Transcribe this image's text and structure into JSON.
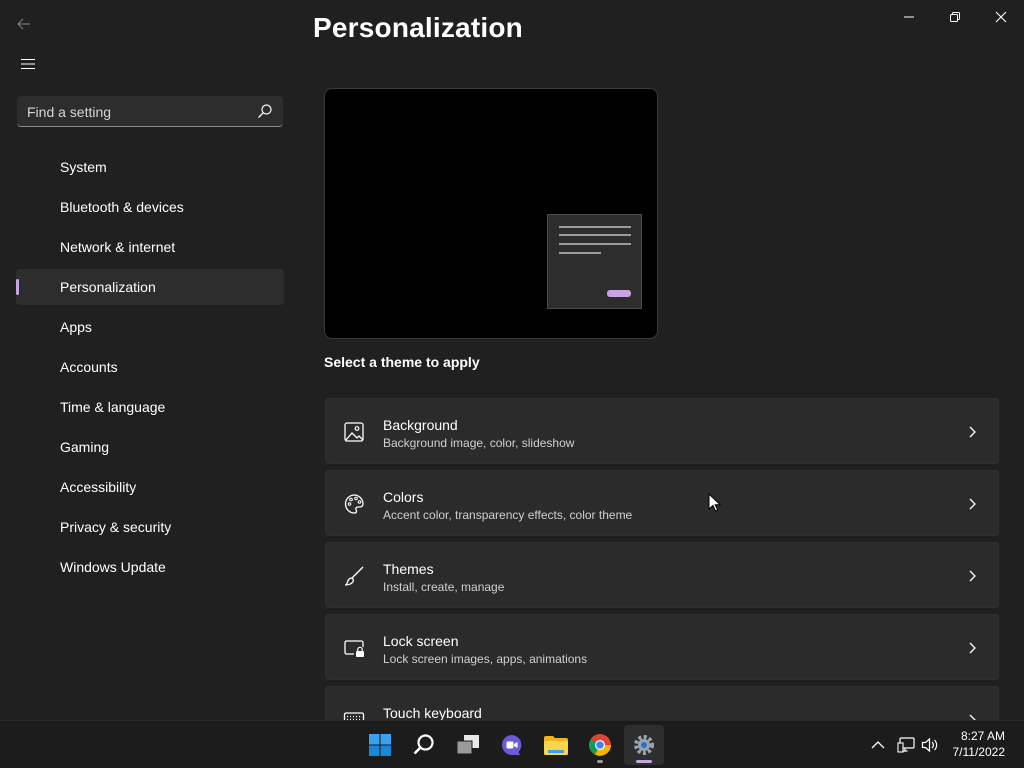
{
  "window": {
    "title": "Personalization"
  },
  "search": {
    "placeholder": "Find a setting"
  },
  "sidebar": {
    "items": [
      {
        "label": "System"
      },
      {
        "label": "Bluetooth & devices"
      },
      {
        "label": "Network & internet"
      },
      {
        "label": "Personalization",
        "selected": true
      },
      {
        "label": "Apps"
      },
      {
        "label": "Accounts"
      },
      {
        "label": "Time & language"
      },
      {
        "label": "Gaming"
      },
      {
        "label": "Accessibility"
      },
      {
        "label": "Privacy & security"
      },
      {
        "label": "Windows Update"
      }
    ]
  },
  "main": {
    "theme_caption": "Select a theme to apply",
    "cards": [
      {
        "title": "Background",
        "subtitle": "Background image, color, slideshow",
        "icon": "image-icon"
      },
      {
        "title": "Colors",
        "subtitle": "Accent color, transparency effects, color theme",
        "icon": "palette-icon"
      },
      {
        "title": "Themes",
        "subtitle": "Install, create, manage",
        "icon": "brush-icon"
      },
      {
        "title": "Lock screen",
        "subtitle": "Lock screen images, apps, animations",
        "icon": "lock-screen-icon"
      },
      {
        "title": "Touch keyboard",
        "subtitle": "",
        "icon": "keyboard-icon"
      }
    ]
  },
  "taskbar": {
    "apps": [
      "start-icon",
      "search-icon",
      "task-view-icon",
      "chat-icon",
      "file-explorer-icon",
      "chrome-icon",
      "settings-icon"
    ],
    "time": "8:27 AM",
    "date": "7/11/2022"
  },
  "colors": {
    "accent": "#c9a4e4",
    "background": "#202020",
    "card": "#2b2b2b"
  }
}
